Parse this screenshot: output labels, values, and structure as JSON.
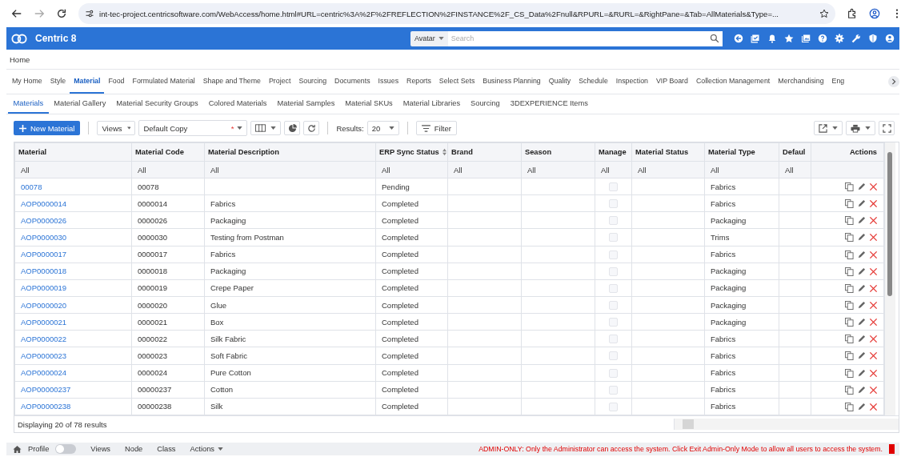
{
  "browser": {
    "url": "int-tec-project.centricsoftware.com/WebAccess/home.html#URL=centric%3A%2F%2FREFLECTION%2FINSTANCE%2F_CS_Data%2Fnull&RPURL=&RURL=&RightPane=&Tab=AllMaterials&Type=..."
  },
  "app": {
    "title": "Centric 8",
    "search_scope": "Avatar",
    "search_placeholder": "Search"
  },
  "breadcrumb": "Home",
  "module_tabs": [
    {
      "label": "My Home",
      "selected": false
    },
    {
      "label": "Style",
      "selected": false
    },
    {
      "label": "Material",
      "selected": true
    },
    {
      "label": "Food",
      "selected": false
    },
    {
      "label": "Formulated Material",
      "selected": false
    },
    {
      "label": "Shape and Theme",
      "selected": false
    },
    {
      "label": "Project",
      "selected": false
    },
    {
      "label": "Sourcing",
      "selected": false
    },
    {
      "label": "Documents",
      "selected": false
    },
    {
      "label": "Issues",
      "selected": false
    },
    {
      "label": "Reports",
      "selected": false
    },
    {
      "label": "Select Sets",
      "selected": false
    },
    {
      "label": "Business Planning",
      "selected": false
    },
    {
      "label": "Quality",
      "selected": false
    },
    {
      "label": "Schedule",
      "selected": false
    },
    {
      "label": "Inspection",
      "selected": false
    },
    {
      "label": "VIP Board",
      "selected": false
    },
    {
      "label": "Collection Management",
      "selected": false
    },
    {
      "label": "Merchandising",
      "selected": false
    },
    {
      "label": "Eng",
      "selected": false
    }
  ],
  "sub_tabs": [
    {
      "label": "Materials",
      "selected": true
    },
    {
      "label": "Material Gallery",
      "selected": false
    },
    {
      "label": "Material Security Groups",
      "selected": false
    },
    {
      "label": "Colored Materials",
      "selected": false
    },
    {
      "label": "Material Samples",
      "selected": false
    },
    {
      "label": "Material SKUs",
      "selected": false
    },
    {
      "label": "Material Libraries",
      "selected": false
    },
    {
      "label": "Sourcing",
      "selected": false
    },
    {
      "label": "3DEXPERIENCE Items",
      "selected": false
    }
  ],
  "toolbar": {
    "new_button": "New Material",
    "views": "Views",
    "view_name": "Default Copy",
    "required_mark": "*",
    "results_label": "Results:",
    "results": "20",
    "filter": "Filter"
  },
  "table": {
    "columns": [
      {
        "label": "Material",
        "sort_icon": false
      },
      {
        "label": "Material Code",
        "sort_icon": false
      },
      {
        "label": "Material Description",
        "sort_icon": false
      },
      {
        "label": "ERP Sync Status",
        "sort_icon": true
      },
      {
        "label": "Brand",
        "sort_icon": false
      },
      {
        "label": "Season",
        "sort_icon": false
      },
      {
        "label": "Manage",
        "sort_icon": false
      },
      {
        "label": "Material Status",
        "sort_icon": false
      },
      {
        "label": "Material Type",
        "sort_icon": false
      },
      {
        "label": "Defaul",
        "sort_icon": false
      },
      {
        "label": "Actions",
        "sort_icon": false
      }
    ],
    "filters": [
      "All",
      "All",
      "All",
      "All",
      "All",
      "All",
      "All",
      "All",
      "All",
      "All"
    ],
    "rows": [
      {
        "material": "00078",
        "code": "00078",
        "description": "",
        "erp": "Pending",
        "manage": false,
        "type": "Fabrics"
      },
      {
        "material": "AOP0000014",
        "code": "0000014",
        "description": "Fabrics",
        "erp": "Completed",
        "manage": false,
        "type": "Fabrics"
      },
      {
        "material": "AOP0000026",
        "code": "0000026",
        "description": "Packaging",
        "erp": "Completed",
        "manage": false,
        "type": "Packaging"
      },
      {
        "material": "AOP0000030",
        "code": "0000030",
        "description": "Testing from Postman",
        "erp": "Completed",
        "manage": false,
        "type": "Trims"
      },
      {
        "material": "AOP0000017",
        "code": "0000017",
        "description": "Fabrics",
        "erp": "Completed",
        "manage": false,
        "type": "Fabrics"
      },
      {
        "material": "AOP0000018",
        "code": "0000018",
        "description": "Packaging",
        "erp": "Completed",
        "manage": false,
        "type": "Packaging"
      },
      {
        "material": "AOP0000019",
        "code": "0000019",
        "description": "Crepe Paper",
        "erp": "Completed",
        "manage": false,
        "type": "Packaging"
      },
      {
        "material": "AOP0000020",
        "code": "0000020",
        "description": "Glue",
        "erp": "Completed",
        "manage": false,
        "type": "Packaging"
      },
      {
        "material": "AOP0000021",
        "code": "0000021",
        "description": "Box",
        "erp": "Completed",
        "manage": false,
        "type": "Packaging"
      },
      {
        "material": "AOP0000022",
        "code": "0000022",
        "description": "Silk Fabric",
        "erp": "Completed",
        "manage": false,
        "type": "Fabrics"
      },
      {
        "material": "AOP0000023",
        "code": "0000023",
        "description": "Soft Fabric",
        "erp": "Completed",
        "manage": false,
        "type": "Fabrics"
      },
      {
        "material": "AOP0000024",
        "code": "0000024",
        "description": "Pure Cotton",
        "erp": "Completed",
        "manage": false,
        "type": "Fabrics"
      },
      {
        "material": "AOP00000237",
        "code": "00000237",
        "description": "Cotton",
        "erp": "Completed",
        "manage": false,
        "type": "Fabrics"
      },
      {
        "material": "AOP00000238",
        "code": "00000238",
        "description": "Silk",
        "erp": "Completed",
        "manage": false,
        "type": "Fabrics"
      }
    ],
    "footer": "Displaying 20 of 78 results"
  },
  "status_bar": {
    "profile": "Profile",
    "profile_on": false,
    "items": [
      "Views",
      "Node",
      "Class"
    ],
    "actions": "Actions",
    "message": "ADMIN-ONLY: Only the Administrator can access the system. Click Exit Admin-Only Mode to allow all users to access the system."
  }
}
